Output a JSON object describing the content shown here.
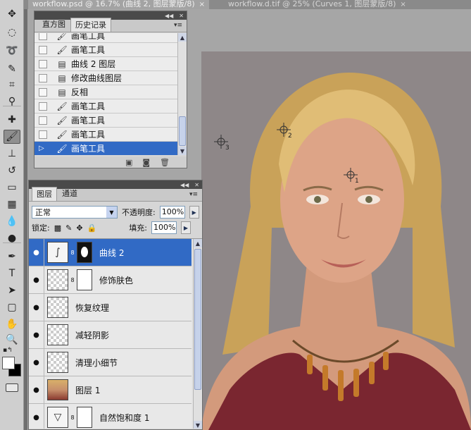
{
  "doc_tabs": [
    {
      "title": "workflow.psd @ 16.7% (曲线 2, 图层蒙版/8)",
      "close": "×"
    },
    {
      "title": "workflow.d.tif @ 25% (Curves 1, 图层蒙版/8)",
      "close": "×"
    }
  ],
  "toolbar": {
    "tools": [
      {
        "name": "move-tool",
        "glyph": "✥"
      },
      {
        "name": "marquee-tool",
        "glyph": "◌"
      },
      {
        "name": "lasso-tool",
        "glyph": "➰"
      },
      {
        "name": "quick-select-tool",
        "glyph": "✎"
      },
      {
        "name": "crop-tool",
        "glyph": "⌗"
      },
      {
        "name": "eyedropper-tool",
        "glyph": "⚲"
      },
      {
        "name": "healing-brush-tool",
        "glyph": "✚"
      },
      {
        "name": "brush-tool",
        "glyph": "🖌"
      },
      {
        "name": "clone-stamp-tool",
        "glyph": "⊥"
      },
      {
        "name": "history-brush-tool",
        "glyph": "↺"
      },
      {
        "name": "eraser-tool",
        "glyph": "▭"
      },
      {
        "name": "gradient-tool",
        "glyph": "▦"
      },
      {
        "name": "blur-tool",
        "glyph": "💧"
      },
      {
        "name": "dodge-tool",
        "glyph": "●"
      },
      {
        "name": "pen-tool",
        "glyph": "✒"
      },
      {
        "name": "type-tool",
        "glyph": "T"
      },
      {
        "name": "path-select-tool",
        "glyph": "➤"
      },
      {
        "name": "shape-tool",
        "glyph": "▢"
      },
      {
        "name": "hand-tool",
        "glyph": "✋"
      },
      {
        "name": "zoom-tool",
        "glyph": "🔍"
      }
    ],
    "active_tool": "brush-tool",
    "foreground_color": "#ffffff",
    "background_color": "#000000"
  },
  "history_panel": {
    "tabs": [
      "直方图",
      "历史记录"
    ],
    "active_tab": "历史记录",
    "items": [
      {
        "icon": "brush-icon",
        "glyph": "🖌",
        "label": "画笔工具"
      },
      {
        "icon": "brush-icon",
        "glyph": "🖌",
        "label": "画笔工具"
      },
      {
        "icon": "document-icon",
        "glyph": "▤",
        "label": "曲线 2 图层"
      },
      {
        "icon": "document-icon",
        "glyph": "▤",
        "label": "修改曲线图层"
      },
      {
        "icon": "document-icon",
        "glyph": "▤",
        "label": "反相"
      },
      {
        "icon": "brush-icon",
        "glyph": "🖌",
        "label": "画笔工具"
      },
      {
        "icon": "brush-icon",
        "glyph": "🖌",
        "label": "画笔工具"
      },
      {
        "icon": "brush-icon",
        "glyph": "🖌",
        "label": "画笔工具"
      },
      {
        "icon": "brush-icon",
        "glyph": "🖌",
        "label": "画笔工具"
      }
    ],
    "footer_icons": [
      "new-document-icon",
      "snapshot-icon",
      "trash-icon"
    ]
  },
  "layers_panel": {
    "tabs": [
      "图层",
      "通道"
    ],
    "active_tab": "图层",
    "blend_mode": "正常",
    "opacity_label": "不透明度:",
    "opacity_value": "100%",
    "lock_label": "锁定:",
    "fill_label": "填充:",
    "fill_value": "100%",
    "layers": [
      {
        "name": "曲线 2",
        "thumb": "curves",
        "mask": "dark",
        "active": true
      },
      {
        "name": "修饰肤色",
        "thumb": "transparent",
        "mask": "light",
        "active": false
      },
      {
        "name": "恢复纹理",
        "thumb": "transparent",
        "mask": null,
        "active": false
      },
      {
        "name": "减轻阴影",
        "thumb": "transparent",
        "mask": null,
        "active": false
      },
      {
        "name": "清理小细节",
        "thumb": "transparent",
        "mask": null,
        "active": false
      },
      {
        "name": "图层 1",
        "thumb": "photo",
        "mask": null,
        "active": false
      },
      {
        "name": "自然饱和度 1",
        "thumb": "vibrance",
        "mask": "light",
        "active": false
      }
    ]
  },
  "canvas": {
    "markers": [
      "1",
      "2",
      "3"
    ],
    "colors": {
      "background": "#8e8788",
      "hair": "#d8b26a",
      "skin": "#d79c7e",
      "top": "#7a2630",
      "necklace": "#c47a2a"
    }
  }
}
